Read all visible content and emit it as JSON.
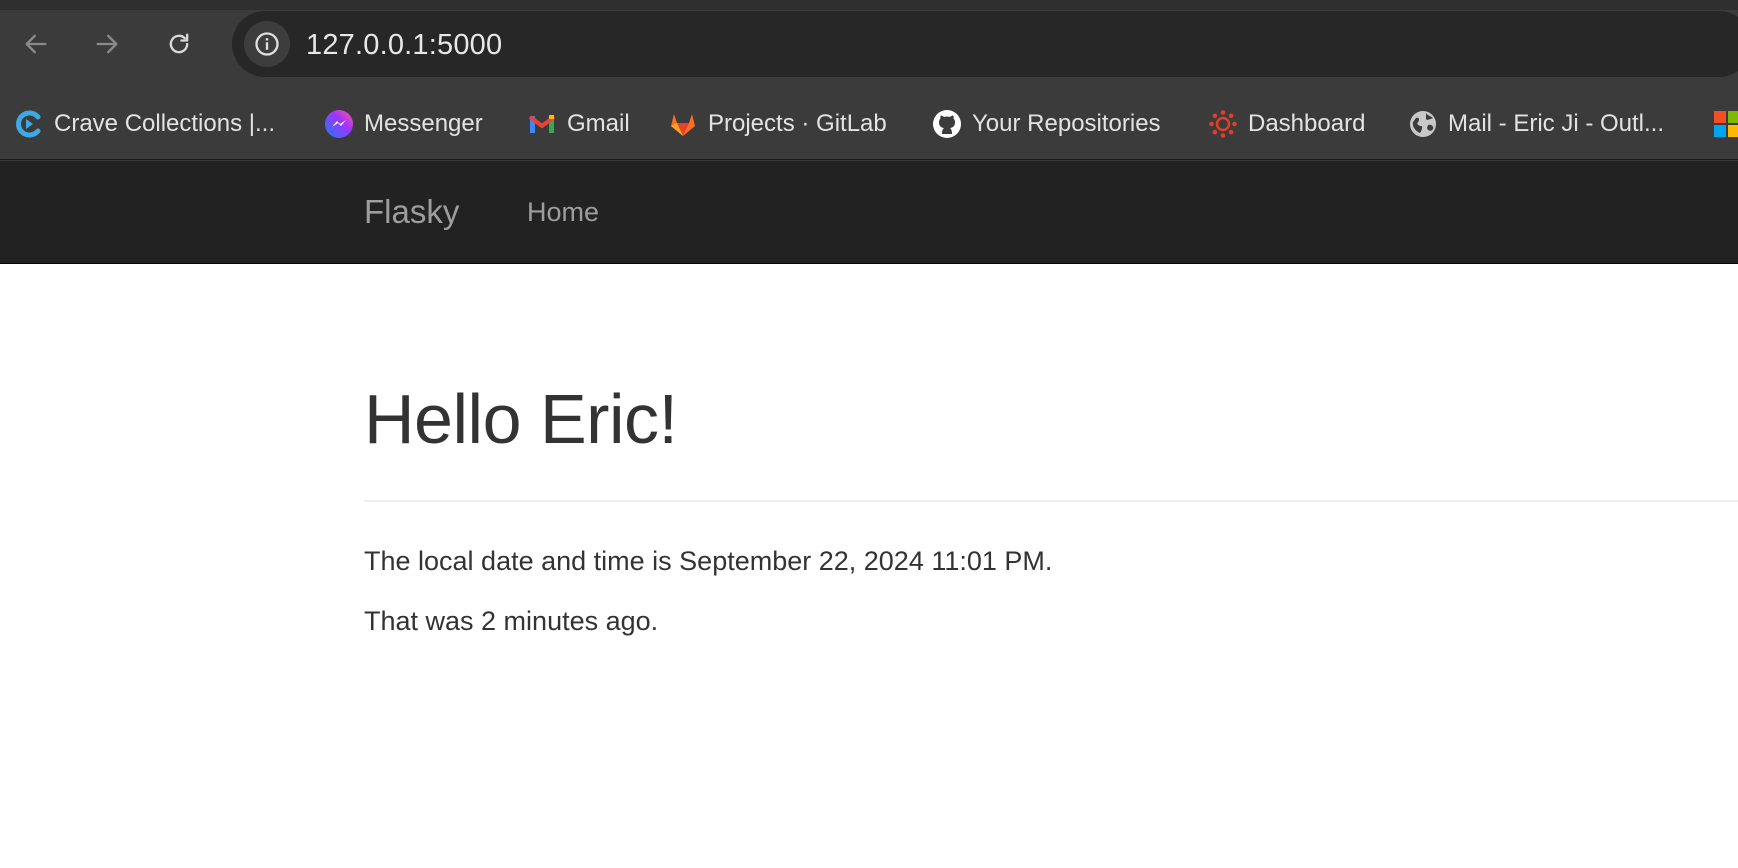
{
  "browser": {
    "url": "127.0.0.1:5000",
    "bookmarks": [
      {
        "label": "Crave Collections |...",
        "icon": "crave-icon"
      },
      {
        "label": "Messenger",
        "icon": "messenger-icon"
      },
      {
        "label": "Gmail",
        "icon": "gmail-icon"
      },
      {
        "label": "Projects · GitLab",
        "icon": "gitlab-icon"
      },
      {
        "label": "Your Repositories",
        "icon": "github-icon"
      },
      {
        "label": "Dashboard",
        "icon": "canvas-icon"
      },
      {
        "label": "Mail - Eric Ji - Outl...",
        "icon": "globe-icon"
      }
    ]
  },
  "navbar": {
    "brand": "Flasky",
    "links": [
      "Home"
    ]
  },
  "page": {
    "heading": "Hello Eric!",
    "local_time_text": "The local date and time is September 22, 2024 11:01 PM.",
    "relative_time_text": "That was 2 minutes ago."
  },
  "colors": {
    "navbar_bg": "#222222",
    "navbar_text": "#9d9d9d",
    "body_text": "#333333",
    "chrome_bg": "#3b3b3b"
  }
}
